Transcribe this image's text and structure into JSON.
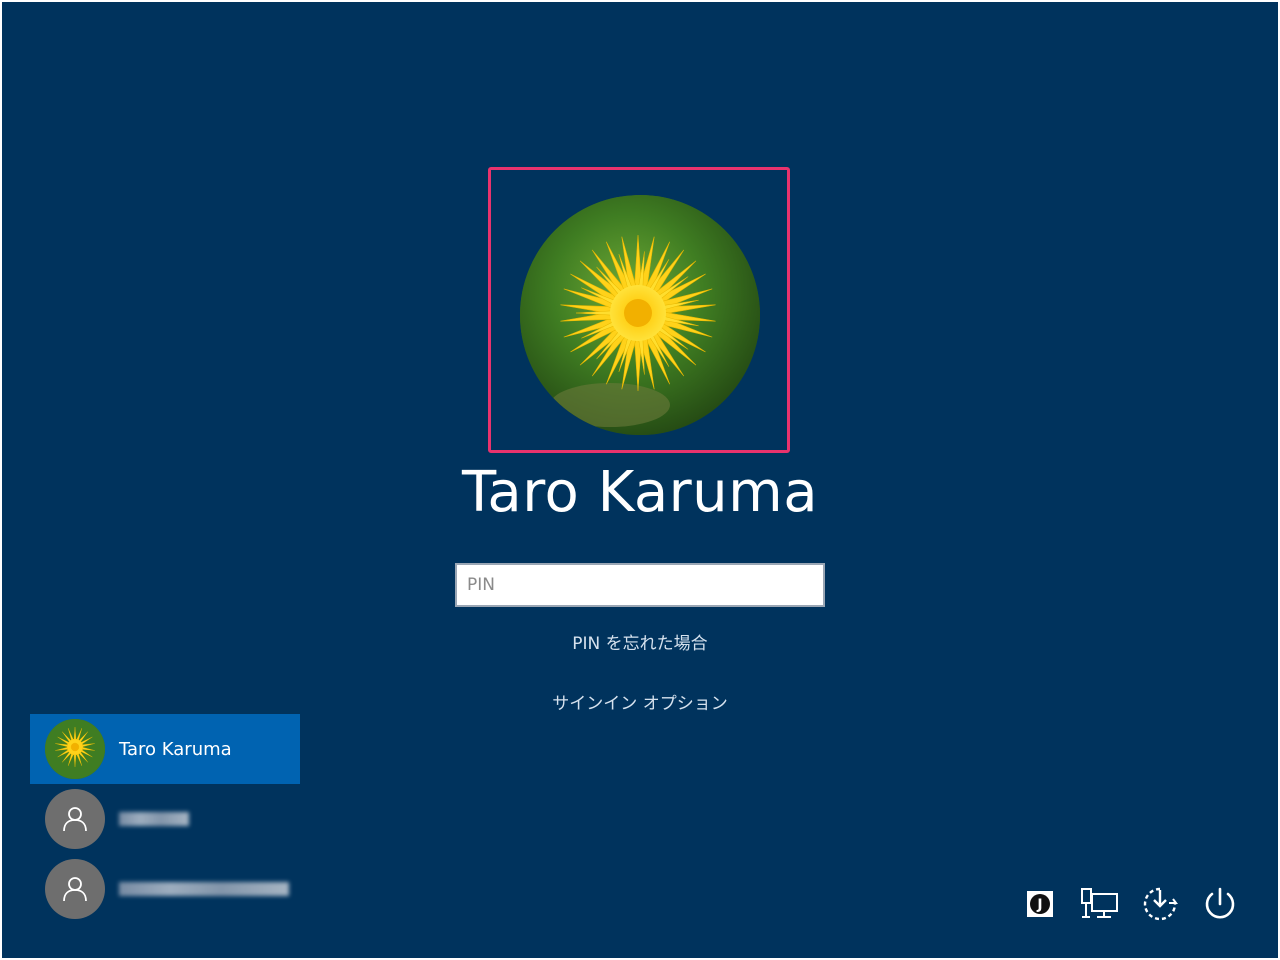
{
  "user": {
    "name": "Taro Karuma"
  },
  "pin": {
    "placeholder": "PIN"
  },
  "links": {
    "forgot_pin": "PIN を忘れた場合",
    "signin_options": "サインイン オプション"
  },
  "user_list": [
    {
      "name": "Taro Karuma",
      "active": true,
      "avatar": "dandelion"
    },
    {
      "name": "",
      "active": false,
      "avatar": "generic-person-icon",
      "obscured": true
    },
    {
      "name": "",
      "active": false,
      "avatar": "generic-person-icon",
      "obscured": true
    }
  ],
  "tray": [
    {
      "icon": "ime-icon"
    },
    {
      "icon": "network-icon"
    },
    {
      "icon": "accessibility-icon"
    },
    {
      "icon": "power-icon"
    }
  ],
  "colors": {
    "background": "#00335d",
    "highlight": "#e8336d",
    "active_user": "#0063b1",
    "generic_avatar": "#6e6e6e"
  }
}
